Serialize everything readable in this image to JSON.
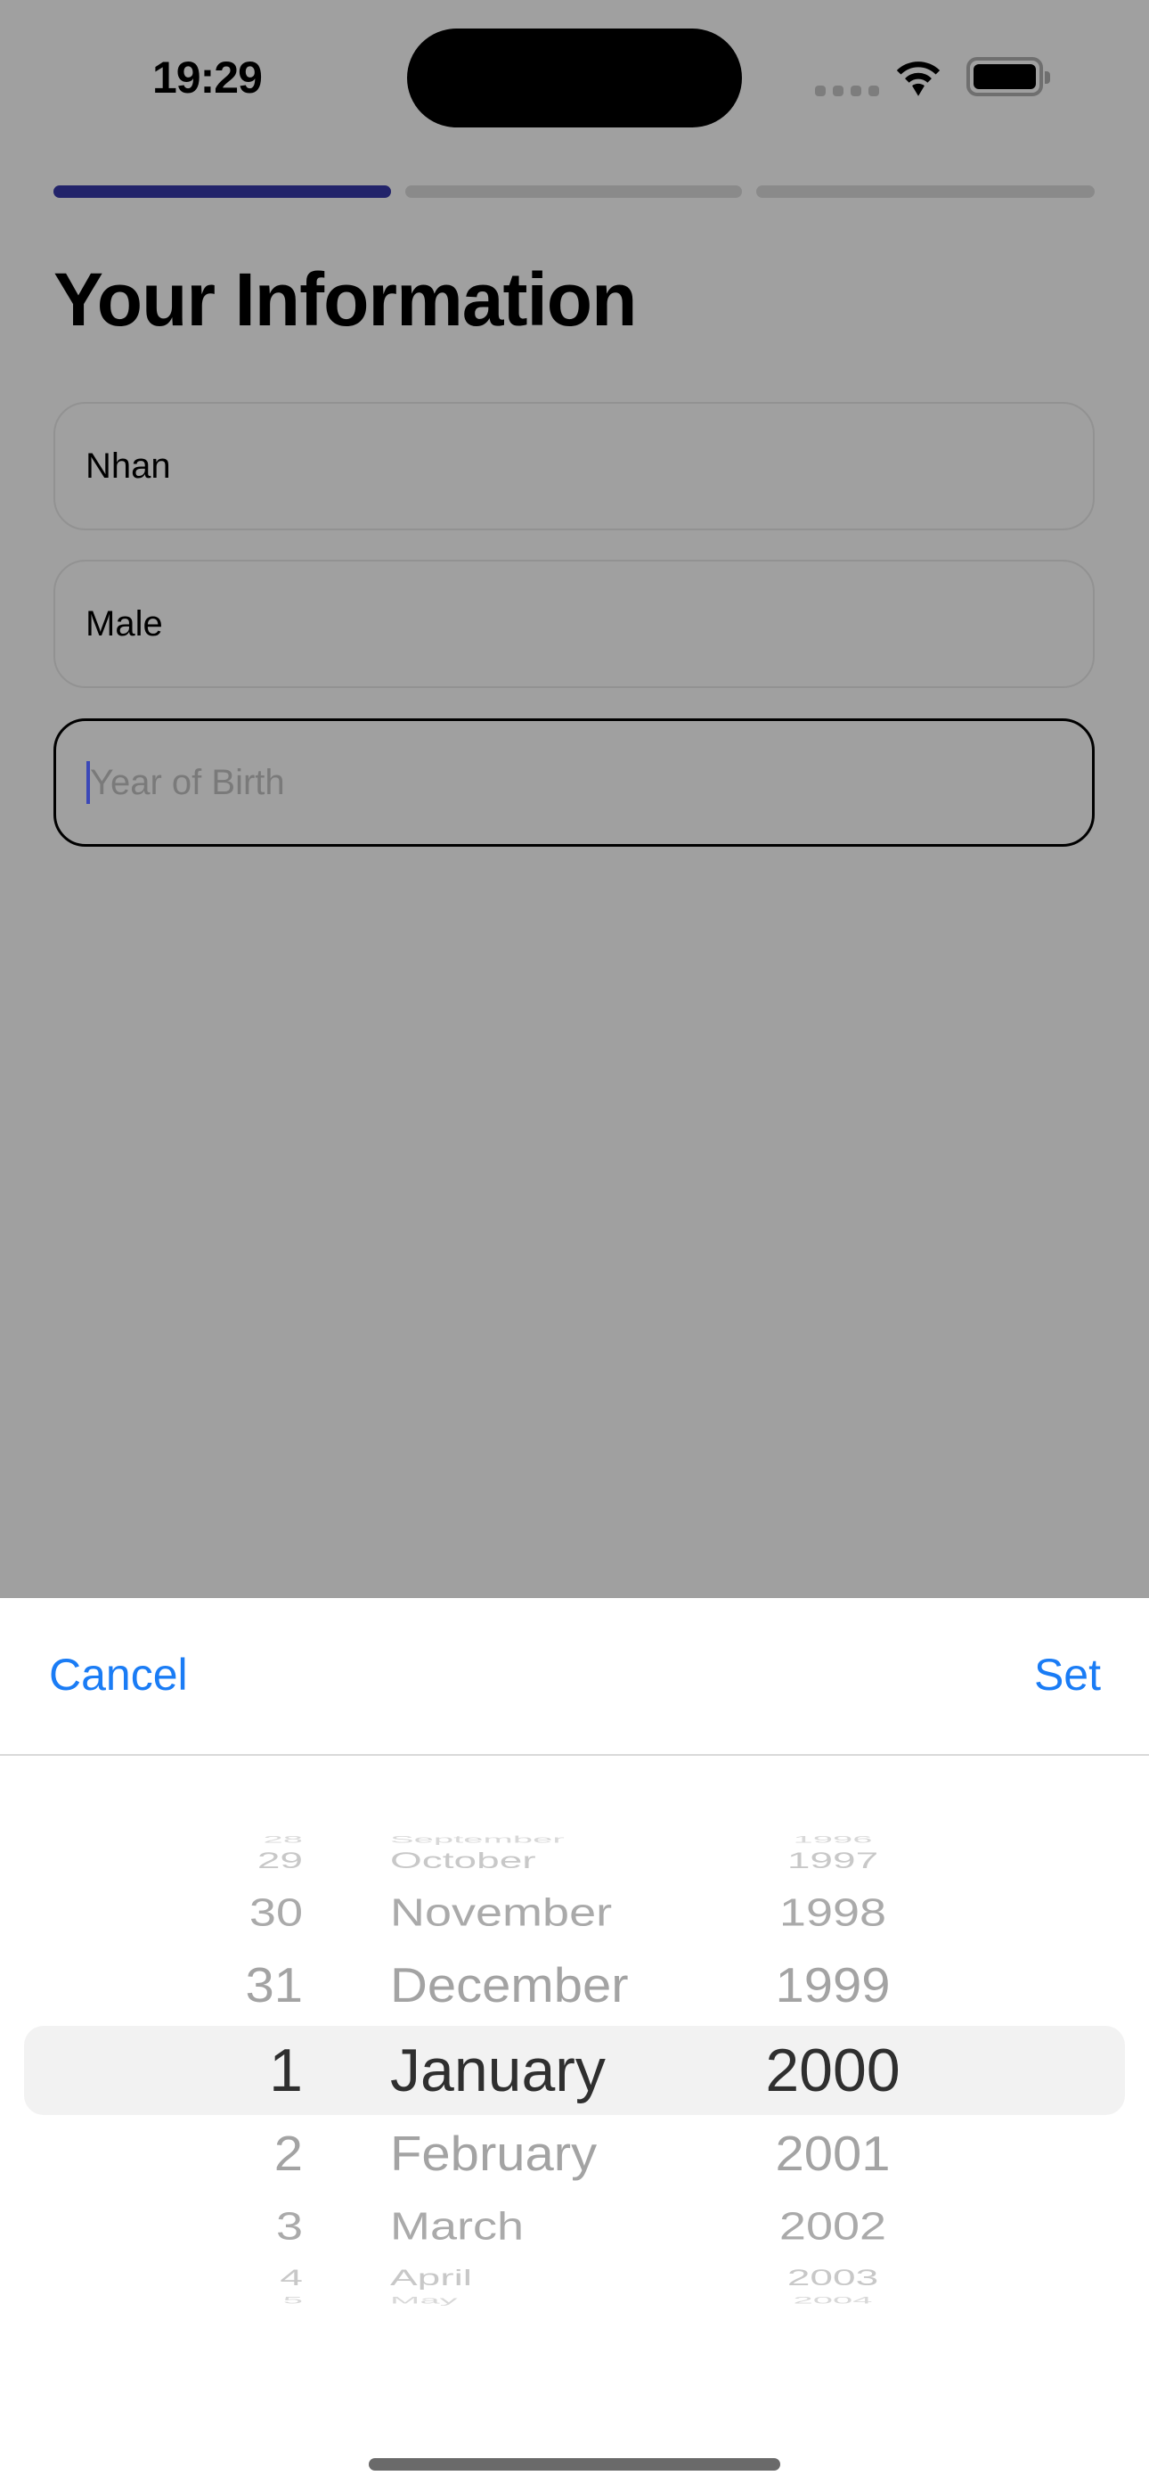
{
  "status_bar": {
    "time": "19:29",
    "icons": [
      "signal-icon",
      "wifi-icon",
      "battery-icon"
    ]
  },
  "progress": {
    "steps_total": 3,
    "current_step": 1,
    "active_color": "#22236a"
  },
  "page": {
    "title": "Your Information"
  },
  "fields": [
    {
      "value": "Nhan",
      "placeholder": ""
    },
    {
      "value": "Male",
      "placeholder": ""
    },
    {
      "value": "",
      "placeholder": "Year of Birth"
    }
  ],
  "sheet": {
    "cancel_label": "Cancel",
    "set_label": "Set",
    "accent": "#1a7cf5"
  },
  "picker": {
    "days": [
      "28",
      "29",
      "30",
      "31",
      "1",
      "2",
      "3",
      "4",
      "5"
    ],
    "months": [
      "September",
      "October",
      "November",
      "December",
      "January",
      "February",
      "March",
      "April",
      "May"
    ],
    "years": [
      "1996",
      "1997",
      "1998",
      "1999",
      "2000",
      "2001",
      "2002",
      "2003",
      "2004"
    ],
    "selected": {
      "day": "1",
      "month": "January",
      "year": "2000"
    }
  }
}
